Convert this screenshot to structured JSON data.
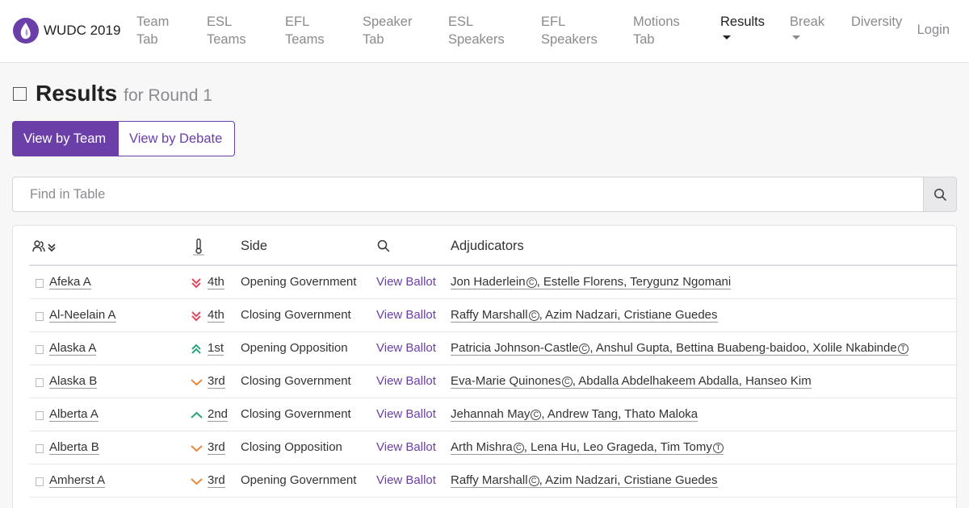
{
  "nav": {
    "brand": "WUDC 2019",
    "items": [
      {
        "line1": "Team",
        "line2": "Tab"
      },
      {
        "line1": "ESL",
        "line2": "Teams"
      },
      {
        "line1": "EFL",
        "line2": "Teams"
      },
      {
        "line1": "Speaker",
        "line2": "Tab"
      },
      {
        "line1": "ESL",
        "line2": "Speakers"
      },
      {
        "line1": "EFL",
        "line2": "Speakers"
      },
      {
        "line1": "Motions",
        "line2": "Tab"
      },
      {
        "line1": "Results",
        "line2": ""
      },
      {
        "line1": "Break",
        "line2": ""
      },
      {
        "line1": "Diversity",
        "line2": ""
      }
    ],
    "login": "Login"
  },
  "page": {
    "title": "Results",
    "subtitle": "for Round 1",
    "view_team": "View by Team",
    "view_debate": "View by Debate",
    "search_placeholder": "Find in Table"
  },
  "table": {
    "headers": {
      "side": "Side",
      "adjudicators": "Adjudicators"
    },
    "rows": [
      {
        "team": "Afeka A",
        "rank": "4th",
        "trend": "down2",
        "side": "Opening Government",
        "ballot": "View Ballot",
        "chair": "Jon Haderlein",
        "chair_mark": "C",
        "adj_rest": ", Estelle Florens, Terygunz Ngomani",
        "trainee": ""
      },
      {
        "team": "Al-Neelain A",
        "rank": "4th",
        "trend": "down2",
        "side": "Closing Government",
        "ballot": "View Ballot",
        "chair": "Raffy Marshall",
        "chair_mark": "C",
        "adj_rest": ", Azim Nadzari, Cristiane Guedes",
        "trainee": ""
      },
      {
        "team": "Alaska A",
        "rank": "1st",
        "trend": "up2",
        "side": "Opening Opposition",
        "ballot": "View Ballot",
        "chair": "Patricia Johnson-Castle",
        "chair_mark": "C",
        "adj_rest": ", Anshul Gupta, Bettina Buabeng-baidoo, Xolile Nkabinde",
        "trainee": "T"
      },
      {
        "team": "Alaska B",
        "rank": "3rd",
        "trend": "down1",
        "side": "Closing Government",
        "ballot": "View Ballot",
        "chair": "Eva-Marie Quinones",
        "chair_mark": "C",
        "adj_rest": ", Abdalla Abdelhakeem Abdalla, Hanseo Kim",
        "trainee": ""
      },
      {
        "team": "Alberta A",
        "rank": "2nd",
        "trend": "up1",
        "side": "Closing Government",
        "ballot": "View Ballot",
        "chair": "Jehannah May",
        "chair_mark": "C",
        "adj_rest": ", Andrew Tang, Thato Maloka",
        "trainee": ""
      },
      {
        "team": "Alberta B",
        "rank": "3rd",
        "trend": "down1",
        "side": "Closing Opposition",
        "ballot": "View Ballot",
        "chair": "Arth Mishra",
        "chair_mark": "C",
        "adj_rest": ", Lena Hu, Leo Grageda, Tim Tomy",
        "trainee": "T"
      },
      {
        "team": "Amherst A",
        "rank": "3rd",
        "trend": "down1",
        "side": "Opening Government",
        "ballot": "View Ballot",
        "chair": "Raffy Marshall",
        "chair_mark": "C",
        "adj_rest": ", Azim Nadzari, Cristiane Guedes",
        "trainee": ""
      }
    ]
  },
  "colors": {
    "accent": "#6a3fa8",
    "down": "#e0485e",
    "down1": "#e8893a",
    "up": "#2aa37a"
  }
}
